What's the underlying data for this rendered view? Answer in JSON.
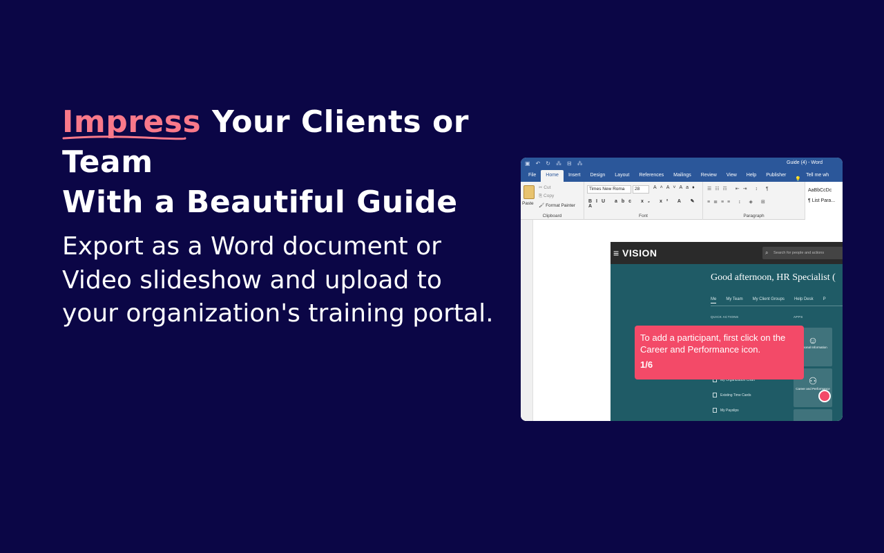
{
  "headline": {
    "accent": "Impress",
    "line1_rest": "Your Clients or Team",
    "line2": "With a Beautiful Guide"
  },
  "body_text": "Export as a Word document or Video slideshow and upload to your organization's training portal.",
  "colors": {
    "background": "#0b0646",
    "accent": "#f9798a",
    "callout": "#f34a68",
    "word_blue": "#2b579a"
  },
  "word_window": {
    "title": "Guide (4)  -  Word",
    "tabs": [
      "File",
      "Home",
      "Insert",
      "Design",
      "Layout",
      "References",
      "Mailings",
      "Review",
      "View",
      "Help",
      "Publisher"
    ],
    "active_tab": "Home",
    "tell_me": "Tell me wh",
    "clipboard": {
      "paste": "Paste",
      "cut": "Cut",
      "copy": "Copy",
      "format_painter": "Format Painter",
      "label": "Clipboard"
    },
    "font": {
      "family": "Times New Roma",
      "size": "28",
      "label": "Font"
    },
    "paragraph_label": "Paragraph",
    "styles": {
      "sample": "AaBbCcDc",
      "name": "¶ List Para..."
    }
  },
  "app": {
    "logo": "≡ VISION",
    "search_placeholder": "Search for people and actions",
    "greeting": "Good afternoon, HR Specialist (",
    "tabs": [
      "Me",
      "My Team",
      "My Client Groups",
      "Help Desk",
      "P"
    ],
    "quick_actions_label": "QUICK ACTIONS",
    "apps_label": "APPS",
    "quick_actions": [
      "My Organization Chart",
      "Existing Time Cards",
      "My Payslips"
    ],
    "tiles": [
      "Personal Information",
      "Career and Performance"
    ],
    "callout": {
      "text": "To add a participant, first click on the Career and Performance icon.",
      "step": "1/6"
    }
  }
}
